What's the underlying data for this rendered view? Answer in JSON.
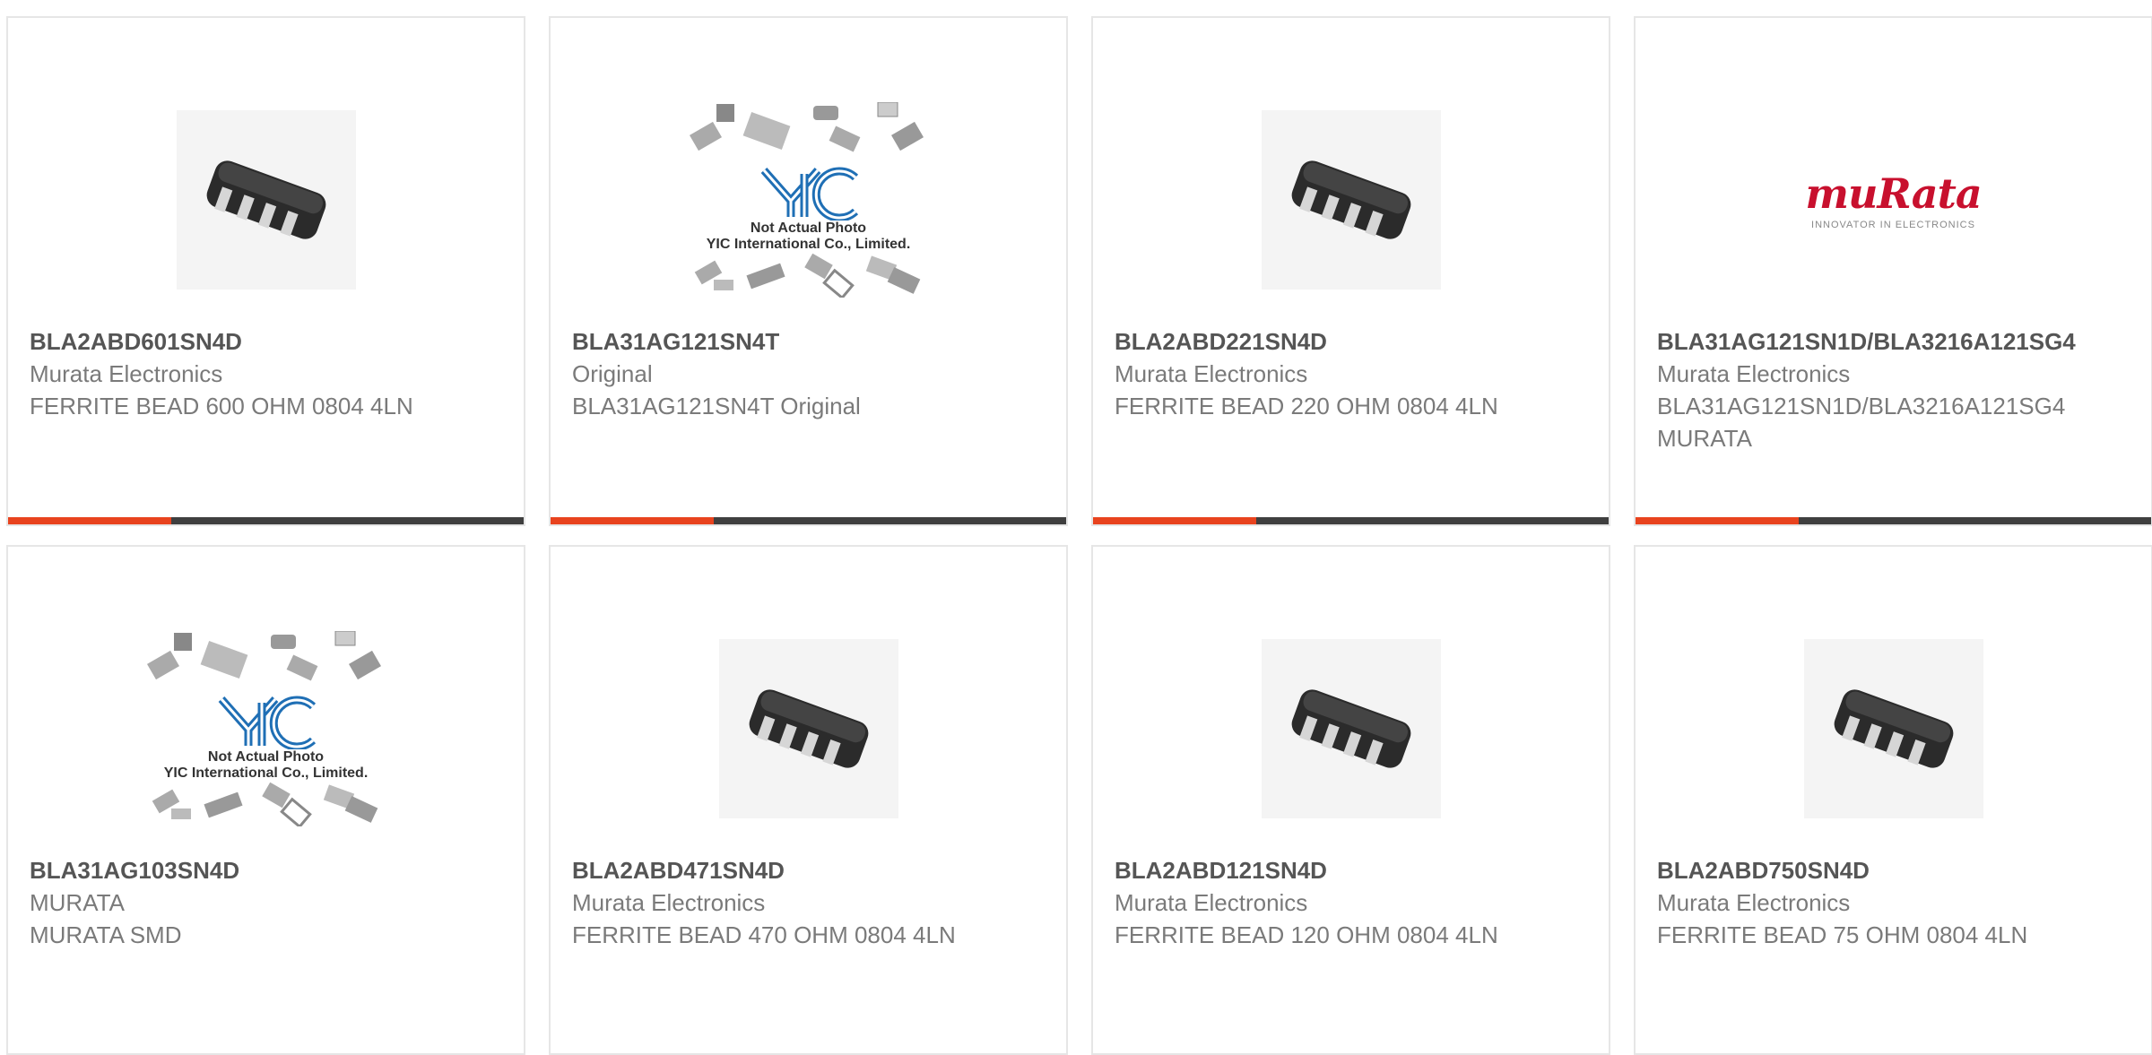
{
  "products": [
    {
      "part": "BLA2ABD601SN4D",
      "manufacturer": "Murata Electronics",
      "description": "FERRITE BEAD 600 OHM 0804 4LN",
      "image": "chip-icon"
    },
    {
      "part": "BLA31AG121SN4T",
      "manufacturer": "Original",
      "description": "BLA31AG121SN4T Original",
      "image": "placeholder-icon"
    },
    {
      "part": "BLA2ABD221SN4D",
      "manufacturer": "Murata Electronics",
      "description": "FERRITE BEAD 220 OHM 0804 4LN",
      "image": "chip-icon"
    },
    {
      "part": "BLA31AG121SN1D/BLA3216A121SG4",
      "manufacturer": "Murata Electronics",
      "description": "BLA31AG121SN1D/BLA3216A121SG4 MURATA",
      "image": "murata-logo"
    },
    {
      "part": "BLA31AG103SN4D",
      "manufacturer": "MURATA",
      "description": "MURATA SMD",
      "image": "placeholder-icon"
    },
    {
      "part": "BLA2ABD471SN4D",
      "manufacturer": "Murata Electronics",
      "description": "FERRITE BEAD 470 OHM 0804 4LN",
      "image": "chip-icon"
    },
    {
      "part": "BLA2ABD121SN4D",
      "manufacturer": "Murata Electronics",
      "description": "FERRITE BEAD 120 OHM 0804 4LN",
      "image": "chip-icon"
    },
    {
      "part": "BLA2ABD750SN4D",
      "manufacturer": "Murata Electronics",
      "description": "FERRITE BEAD 75 OHM 0804 4LN",
      "image": "chip-icon"
    }
  ],
  "placeholder": {
    "brand": "YIC",
    "line1": "Not Actual Photo",
    "line2": "YIC International Co., Limited."
  },
  "murata_logo": {
    "word": "muRata",
    "tagline": "INNOVATOR IN ELECTRONICS"
  },
  "colors": {
    "accent": "#e8431e",
    "bar": "#3f3f3f",
    "murata_red": "#c8102e",
    "yic_blue": "#1f6fb5"
  }
}
